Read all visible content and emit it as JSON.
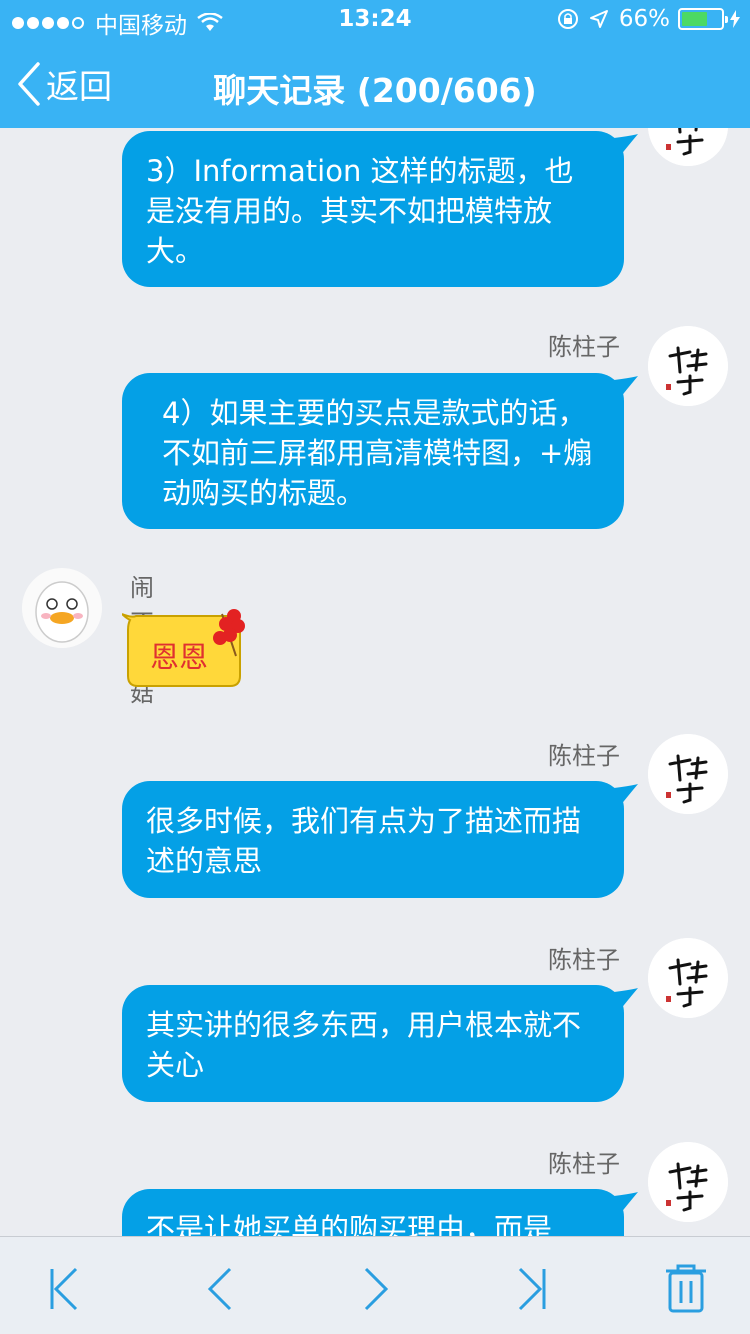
{
  "status_bar": {
    "carrier": "中国移动",
    "time": "13:24",
    "battery_percent": "66%",
    "battery_level": 0.66
  },
  "nav": {
    "back_label": "返回",
    "title": "聊天记录 (200/606)"
  },
  "messages": [
    {
      "sender": "",
      "text": "3）Information 这样的标题，也是没有用的。其实不如把模特放大。"
    },
    {
      "sender": "陈柱子",
      "text": "4）如果主要的买点是款式的话，不如前三屏都用高清模特图，+煽动购买的标题。"
    },
    {
      "sender": "闹不住菇",
      "sticker_text": "恩恩"
    },
    {
      "sender": "陈柱子",
      "text": "很多时候，我们有点为了描述而描述的意思"
    },
    {
      "sender": "陈柱子",
      "text": "其实讲的很多东西，用户根本就不关心"
    },
    {
      "sender": "陈柱子",
      "text": "不是让她买单的购买理由，而是"
    }
  ],
  "toolbar": {
    "first_icon": "first-page-icon",
    "prev_icon": "prev-icon",
    "next_icon": "next-icon",
    "last_icon": "last-page-icon",
    "delete_icon": "trash-icon"
  },
  "colors": {
    "header": "#39b3f4",
    "bubble": "#04a0e6",
    "background": "#ebedf1",
    "toolbar_icon": "#2a9ee0"
  }
}
